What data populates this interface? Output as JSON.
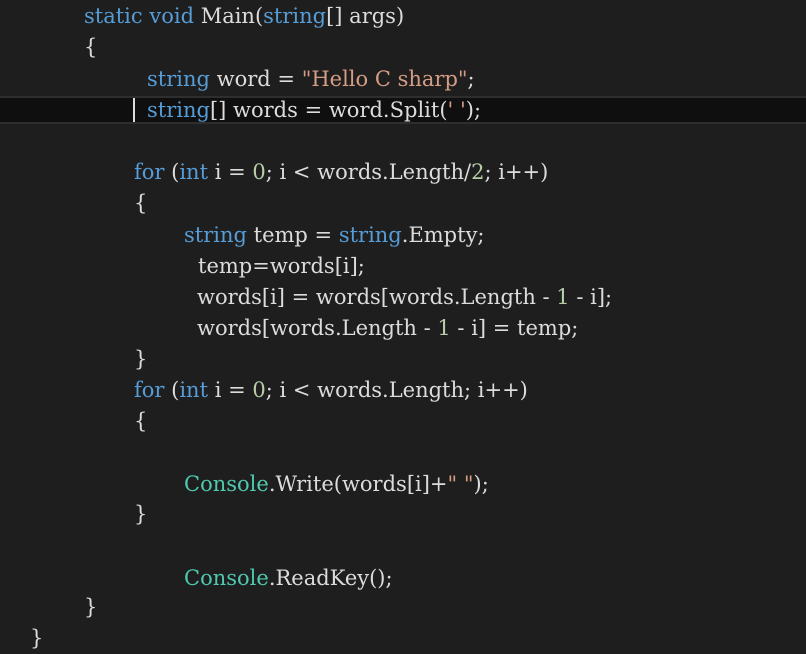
{
  "editor": {
    "lines": [
      {
        "id": "l01",
        "tokens": [
          [
            "kw",
            "static"
          ],
          [
            "pl",
            " "
          ],
          [
            "kw",
            "void"
          ],
          [
            "pl",
            " Main("
          ],
          [
            "kw",
            "string"
          ],
          [
            "pl",
            "[] args)"
          ]
        ]
      },
      {
        "id": "l02",
        "tokens": [
          [
            "pl",
            "{"
          ]
        ]
      },
      {
        "id": "l03",
        "tokens": [
          [
            "kw",
            "string"
          ],
          [
            "pl",
            " word = "
          ],
          [
            "str",
            "\"Hello C sharp\""
          ],
          [
            "pl",
            ";"
          ]
        ]
      },
      {
        "id": "l04",
        "tokens": [
          [
            "kw",
            "string"
          ],
          [
            "pl",
            "[] words = word.Split("
          ],
          [
            "str",
            "' '"
          ],
          [
            "pl",
            ");"
          ]
        ]
      },
      {
        "id": "l05",
        "tokens": [
          [
            "kw",
            "for"
          ],
          [
            "pl",
            " ("
          ],
          [
            "kw",
            "int"
          ],
          [
            "pl",
            " i = "
          ],
          [
            "num",
            "0"
          ],
          [
            "pl",
            "; i < words.Length/"
          ],
          [
            "num",
            "2"
          ],
          [
            "pl",
            "; i++)"
          ]
        ]
      },
      {
        "id": "l06",
        "tokens": [
          [
            "pl",
            "{"
          ]
        ]
      },
      {
        "id": "l07",
        "tokens": [
          [
            "kw",
            "string"
          ],
          [
            "pl",
            " temp = "
          ],
          [
            "kw",
            "string"
          ],
          [
            "pl",
            ".Empty;"
          ]
        ]
      },
      {
        "id": "l08",
        "tokens": [
          [
            "pl",
            "temp=words[i];"
          ]
        ]
      },
      {
        "id": "l09",
        "tokens": [
          [
            "pl",
            "words[i] = words[words.Length - "
          ],
          [
            "num",
            "1"
          ],
          [
            "pl",
            " - i];"
          ]
        ]
      },
      {
        "id": "l10",
        "tokens": [
          [
            "pl",
            "words[words.Length - "
          ],
          [
            "num",
            "1"
          ],
          [
            "pl",
            " - i] = temp;"
          ]
        ]
      },
      {
        "id": "l11",
        "tokens": [
          [
            "pl",
            "}"
          ]
        ]
      },
      {
        "id": "l12",
        "tokens": [
          [
            "kw",
            "for"
          ],
          [
            "pl",
            " ("
          ],
          [
            "kw",
            "int"
          ],
          [
            "pl",
            " i = "
          ],
          [
            "num",
            "0"
          ],
          [
            "pl",
            "; i < words.Length; i++)"
          ]
        ]
      },
      {
        "id": "l13",
        "tokens": [
          [
            "pl",
            "{"
          ]
        ]
      },
      {
        "id": "l14",
        "tokens": [
          [
            "cls",
            "Console"
          ],
          [
            "pl",
            ".Write(words[i]+"
          ],
          [
            "str",
            "\" \""
          ],
          [
            "pl",
            ");"
          ]
        ]
      },
      {
        "id": "l15",
        "tokens": [
          [
            "pl",
            "}"
          ]
        ]
      },
      {
        "id": "l16",
        "tokens": [
          [
            "cls",
            "Console"
          ],
          [
            "pl",
            ".ReadKey();"
          ]
        ]
      },
      {
        "id": "l17",
        "tokens": [
          [
            "pl",
            "}"
          ]
        ]
      },
      {
        "id": "l18",
        "tokens": [
          [
            "pl",
            "}"
          ]
        ]
      }
    ],
    "colors": {
      "background": "#1e1e1e",
      "keyword": "#569cd6",
      "string": "#d69d85",
      "number": "#b5cea8",
      "class": "#4ec9b0",
      "plain": "#dcdcdc"
    }
  }
}
